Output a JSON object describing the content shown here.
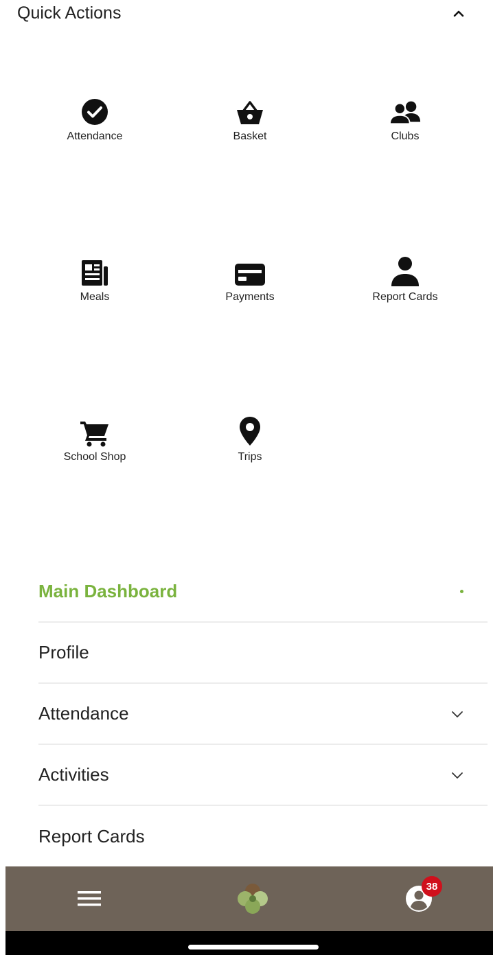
{
  "quick_actions": {
    "title": "Quick Actions",
    "toggle_icon": "chevron-up-icon",
    "tiles": [
      {
        "label": "Attendance",
        "icon": "check-circle-icon"
      },
      {
        "label": "Basket",
        "icon": "basket-icon"
      },
      {
        "label": "Clubs",
        "icon": "people-icon"
      },
      {
        "label": "Meals",
        "icon": "newspaper-icon"
      },
      {
        "label": "Payments",
        "icon": "credit-card-icon"
      },
      {
        "label": "Report Cards",
        "icon": "person-icon"
      },
      {
        "label": "School Shop",
        "icon": "cart-icon"
      },
      {
        "label": "Trips",
        "icon": "location-pin-icon"
      }
    ]
  },
  "menu": {
    "items": [
      {
        "label": "Main Dashboard",
        "active": true
      },
      {
        "label": "Profile"
      },
      {
        "label": "Attendance",
        "expandable": true
      },
      {
        "label": "Activities",
        "expandable": true
      },
      {
        "label": "Report Cards"
      }
    ]
  },
  "bottom_nav": {
    "menu_icon": "hamburger-menu-icon",
    "logo_icon": "clover-logo-icon",
    "account_icon": "account-circle-icon",
    "notification_count": "38"
  },
  "colors": {
    "accent_green": "#7ab33e",
    "nav_background": "#6e6358",
    "badge_red": "#d0101c"
  }
}
